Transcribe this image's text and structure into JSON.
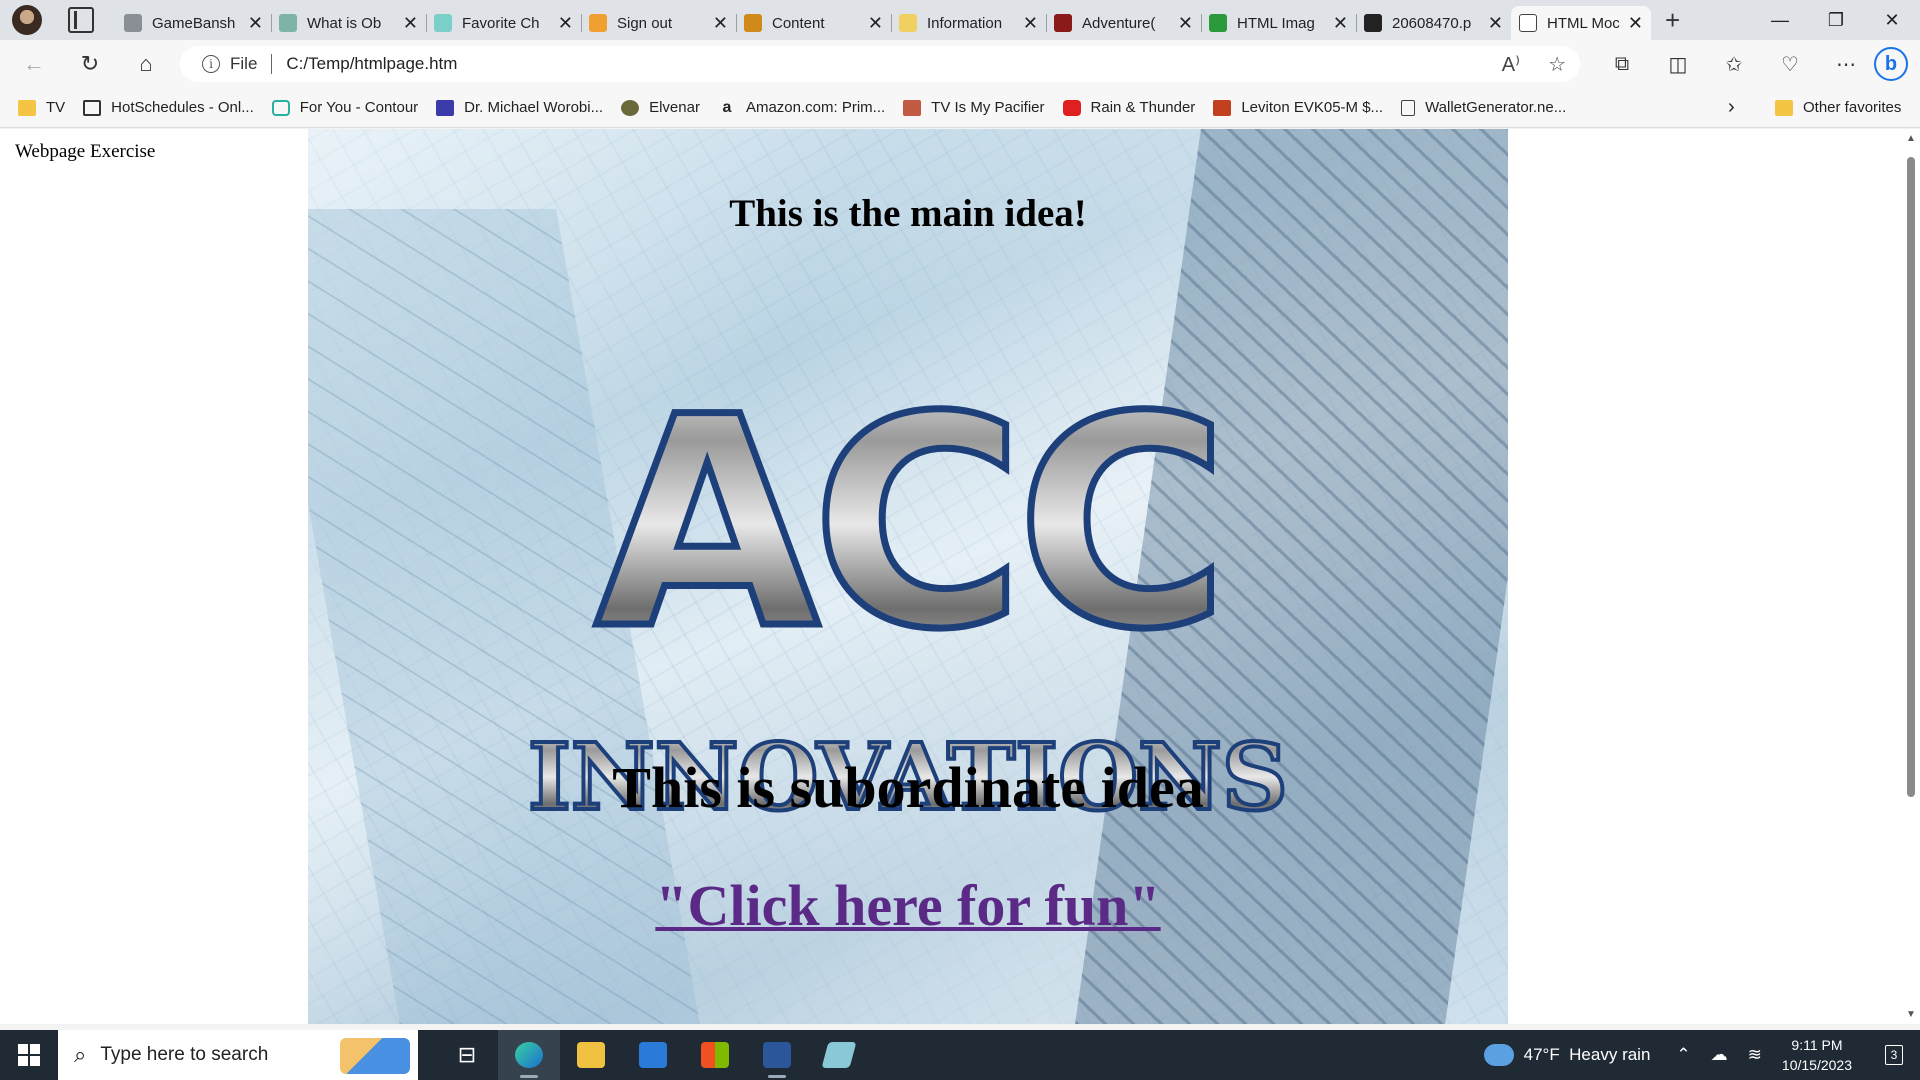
{
  "browser": {
    "tabs": [
      {
        "title": "GameBansh",
        "favicon_color": "#8a8f96",
        "active": false
      },
      {
        "title": "What is Ob",
        "favicon_color": "#7fb3a8",
        "active": false
      },
      {
        "title": "Favorite Ch",
        "favicon_color": "#7ad0c8",
        "active": false
      },
      {
        "title": "Sign out",
        "favicon_color": "#f0a030",
        "active": false
      },
      {
        "title": "Content",
        "favicon_color": "#d08a1a",
        "active": false
      },
      {
        "title": "Information",
        "favicon_color": "#f0d060",
        "active": false
      },
      {
        "title": "Adventure(",
        "favicon_color": "#8a1a1a",
        "active": false
      },
      {
        "title": "HTML Imag",
        "favicon_color": "#2a9a3a",
        "active": false
      },
      {
        "title": "20608470.p",
        "favicon_color": "#222222",
        "active": false
      },
      {
        "title": "HTML Moc",
        "favicon_color": "#ffffff",
        "active": true
      }
    ],
    "address": {
      "scheme_label": "File",
      "url": "C:/Temp/htmlpage.htm"
    },
    "favorites": [
      {
        "label": "TV",
        "icon": "folder-icon",
        "color": "#f4c542"
      },
      {
        "label": "HotSchedules - Onl...",
        "icon": "grid-icon",
        "color": "#333333"
      },
      {
        "label": "For You - Contour",
        "icon": "tv-icon",
        "color": "#2ab0a0"
      },
      {
        "label": "Dr. Michael Worobi...",
        "icon": "heart-icon",
        "color": "#3a3aa8"
      },
      {
        "label": "Elvenar",
        "icon": "elvenar-icon",
        "color": "#6a6a3a"
      },
      {
        "label": "Amazon.com: Prim...",
        "icon": "amazon-icon",
        "color": "#222222"
      },
      {
        "label": "TV Is My Pacifier",
        "icon": "tv-pacifier-icon",
        "color": "#c05a40"
      },
      {
        "label": "Rain & Thunder",
        "icon": "youtube-icon",
        "color": "#e02020"
      },
      {
        "label": "Leviton EVK05-M $...",
        "icon": "leviton-icon",
        "color": "#c04020"
      },
      {
        "label": "WalletGenerator.ne...",
        "icon": "page-icon",
        "color": "#ffffff"
      }
    ],
    "other_favorites": "Other favorites"
  },
  "page": {
    "label": "Webpage Exercise",
    "main_idea": "This is the main idea!",
    "logo_top": "ACC",
    "logo_bottom": "INNOVATIONS",
    "subordinate": "This is subordinate idea",
    "link_text": "\"Click here for fun\""
  },
  "taskbar": {
    "search_placeholder": "Type here to search",
    "weather_temp": "47°F",
    "weather_desc": "Heavy rain",
    "time": "9:11 PM",
    "date": "10/15/2023",
    "notification_count": "3"
  },
  "colors": {
    "link": "#5b2a86",
    "titlebar": "#dfe3e8",
    "taskbar": "#1f2a35"
  }
}
